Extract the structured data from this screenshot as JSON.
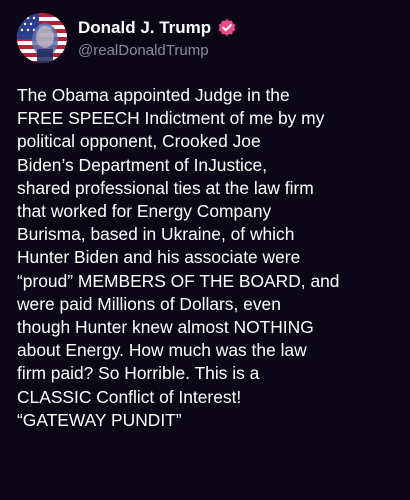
{
  "post": {
    "author": {
      "display_name": "Donald J. Trump",
      "handle": "@realDonaldTrump",
      "verified": true,
      "avatar_icon": "flag-portrait-avatar",
      "verified_icon": "verified-badge-icon"
    },
    "body_lines": [
      "The Obama appointed Judge in the",
      "FREE SPEECH Indictment of me by my",
      "political opponent, Crooked Joe",
      "Biden’s Department of InJustice,",
      "shared professional ties at the law firm",
      "that worked for Energy Company",
      "Burisma, based in Ukraine, of which",
      "Hunter Biden and his associate were",
      "“proud” MEMBERS OF THE BOARD, and",
      "were paid Millions of Dollars, even",
      "though Hunter knew almost NOTHING",
      "about Energy. How much was the law",
      "firm paid? So Horrible. This is a",
      "CLASSIC Conflict of Interest!",
      "“GATEWAY PUNDIT”"
    ]
  },
  "colors": {
    "background": "#0b0717",
    "text": "#ffffff",
    "handle": "#8d8a9b",
    "verified_badge": "#e84c87"
  }
}
